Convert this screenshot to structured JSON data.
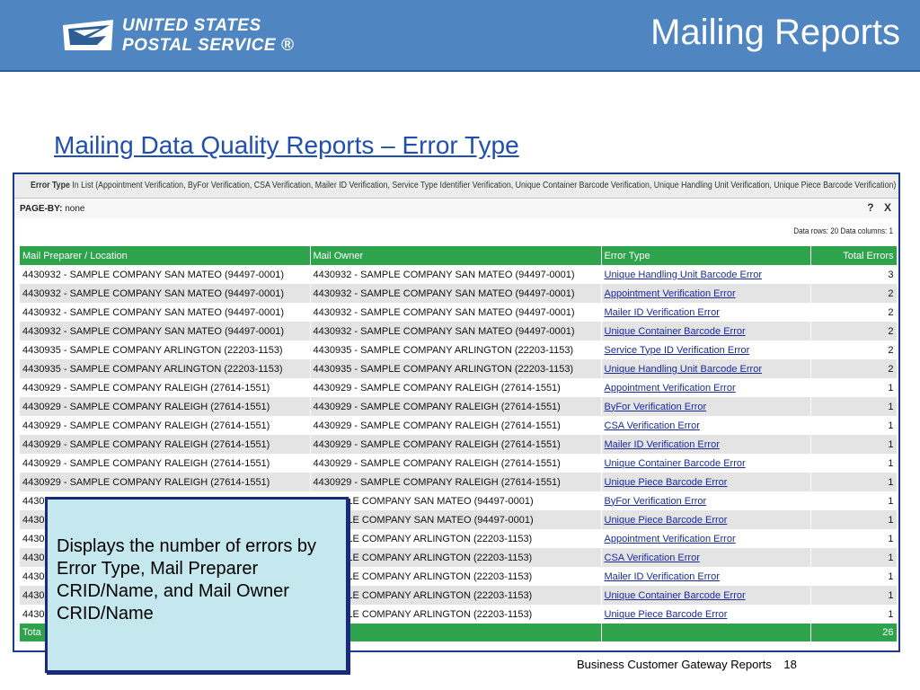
{
  "header": {
    "logo_line1": "UNITED STATES",
    "logo_line2": "POSTAL SERVICE ®",
    "slide_title": "Mailing Reports",
    "bar_color": "#4f86c1"
  },
  "subtitle": "Mailing Data Quality Reports – Error Type",
  "report": {
    "filter_label": "Error Type",
    "filter_value": "In List (Appointment Verification, ByFor Verification, CSA Verification, Mailer ID Verification, Service Type Identifier Verification, Unique Container Barcode Verification, Unique Handling Unit Verification, Unique Piece Barcode Verification)",
    "pageby_label": "PAGE-BY:",
    "pageby_value": "none",
    "help_icon": "?",
    "close_icon": "X",
    "data_info": "Data rows: 20   Data columns: 1",
    "header_color": "#2fa34c",
    "columns": [
      "Mail Preparer / Location",
      "Mail Owner",
      "Error Type",
      "Total Errors"
    ],
    "rows": [
      {
        "preparer": "4430932 - SAMPLE COMPANY SAN MATEO (94497-0001)",
        "owner": "4430932 - SAMPLE COMPANY SAN MATEO (94497-0001)",
        "error": "Unique Handling Unit Barcode Error",
        "total": "3"
      },
      {
        "preparer": "4430932 - SAMPLE COMPANY SAN MATEO (94497-0001)",
        "owner": "4430932 - SAMPLE COMPANY SAN MATEO (94497-0001)",
        "error": "Appointment Verification Error",
        "total": "2"
      },
      {
        "preparer": "4430932 - SAMPLE COMPANY SAN MATEO (94497-0001)",
        "owner": "4430932 - SAMPLE COMPANY SAN MATEO (94497-0001)",
        "error": "Mailer ID Verification Error",
        "total": "2"
      },
      {
        "preparer": "4430932 - SAMPLE COMPANY SAN MATEO (94497-0001)",
        "owner": "4430932 - SAMPLE COMPANY SAN MATEO (94497-0001)",
        "error": "Unique Container Barcode Error",
        "total": "2"
      },
      {
        "preparer": "4430935 - SAMPLE COMPANY ARLINGTON (22203-1153)",
        "owner": "4430935 - SAMPLE COMPANY ARLINGTON (22203-1153)",
        "error": "Service Type ID Verification Error",
        "total": "2"
      },
      {
        "preparer": "4430935 - SAMPLE COMPANY ARLINGTON (22203-1153)",
        "owner": "4430935 - SAMPLE COMPANY ARLINGTON (22203-1153)",
        "error": "Unique Handling Unit Barcode Error",
        "total": "2"
      },
      {
        "preparer": "4430929 - SAMPLE COMPANY RALEIGH (27614-1551)",
        "owner": "4430929 - SAMPLE COMPANY RALEIGH (27614-1551)",
        "error": "Appointment Verification Error",
        "total": "1"
      },
      {
        "preparer": "4430929 - SAMPLE COMPANY RALEIGH (27614-1551)",
        "owner": "4430929 - SAMPLE COMPANY RALEIGH (27614-1551)",
        "error": "ByFor Verification Error",
        "total": "1"
      },
      {
        "preparer": "4430929 - SAMPLE COMPANY RALEIGH (27614-1551)",
        "owner": "4430929 - SAMPLE COMPANY RALEIGH (27614-1551)",
        "error": "CSA Verification Error",
        "total": "1"
      },
      {
        "preparer": "4430929 - SAMPLE COMPANY RALEIGH (27614-1551)",
        "owner": "4430929 - SAMPLE COMPANY RALEIGH (27614-1551)",
        "error": "Mailer ID Verification Error",
        "total": "1"
      },
      {
        "preparer": "4430929 - SAMPLE COMPANY RALEIGH (27614-1551)",
        "owner": "4430929 - SAMPLE COMPANY RALEIGH (27614-1551)",
        "error": "Unique Container Barcode Error",
        "total": "1"
      },
      {
        "preparer": "4430929 - SAMPLE COMPANY RALEIGH (27614-1551)",
        "owner": "4430929 - SAMPLE COMPANY RALEIGH (27614-1551)",
        "error": "Unique Piece Barcode Error",
        "total": "1"
      },
      {
        "preparer": "4430",
        "owner": "- SAMPLE COMPANY SAN MATEO (94497-0001)",
        "error": "ByFor Verification Error",
        "total": "1"
      },
      {
        "preparer": "4430",
        "owner": "- SAMPLE COMPANY SAN MATEO (94497-0001)",
        "error": "Unique Piece Barcode Error",
        "total": "1"
      },
      {
        "preparer": "4430",
        "owner": "- SAMPLE COMPANY ARLINGTON (22203-1153)",
        "error": "Appointment Verification Error",
        "total": "1"
      },
      {
        "preparer": "4430",
        "owner": "- SAMPLE COMPANY ARLINGTON (22203-1153)",
        "error": "CSA Verification Error",
        "total": "1"
      },
      {
        "preparer": "4430",
        "owner": "- SAMPLE COMPANY ARLINGTON (22203-1153)",
        "error": "Mailer ID Verification Error",
        "total": "1"
      },
      {
        "preparer": "4430",
        "owner": "- SAMPLE COMPANY ARLINGTON (22203-1153)",
        "error": "Unique Container Barcode Error",
        "total": "1"
      },
      {
        "preparer": "4430",
        "owner": "- SAMPLE COMPANY ARLINGTON (22203-1153)",
        "error": "Unique Piece Barcode Error",
        "total": "1"
      }
    ],
    "total_label": "Tota",
    "total_value": "26"
  },
  "callout": {
    "text": "Displays the number of errors by Error Type, Mail Preparer CRID/Name, and Mail Owner CRID/Name",
    "bg_color": "#c5e7ee"
  },
  "footer": {
    "label": "Business Customer Gateway  Reports",
    "page_number": "18"
  }
}
